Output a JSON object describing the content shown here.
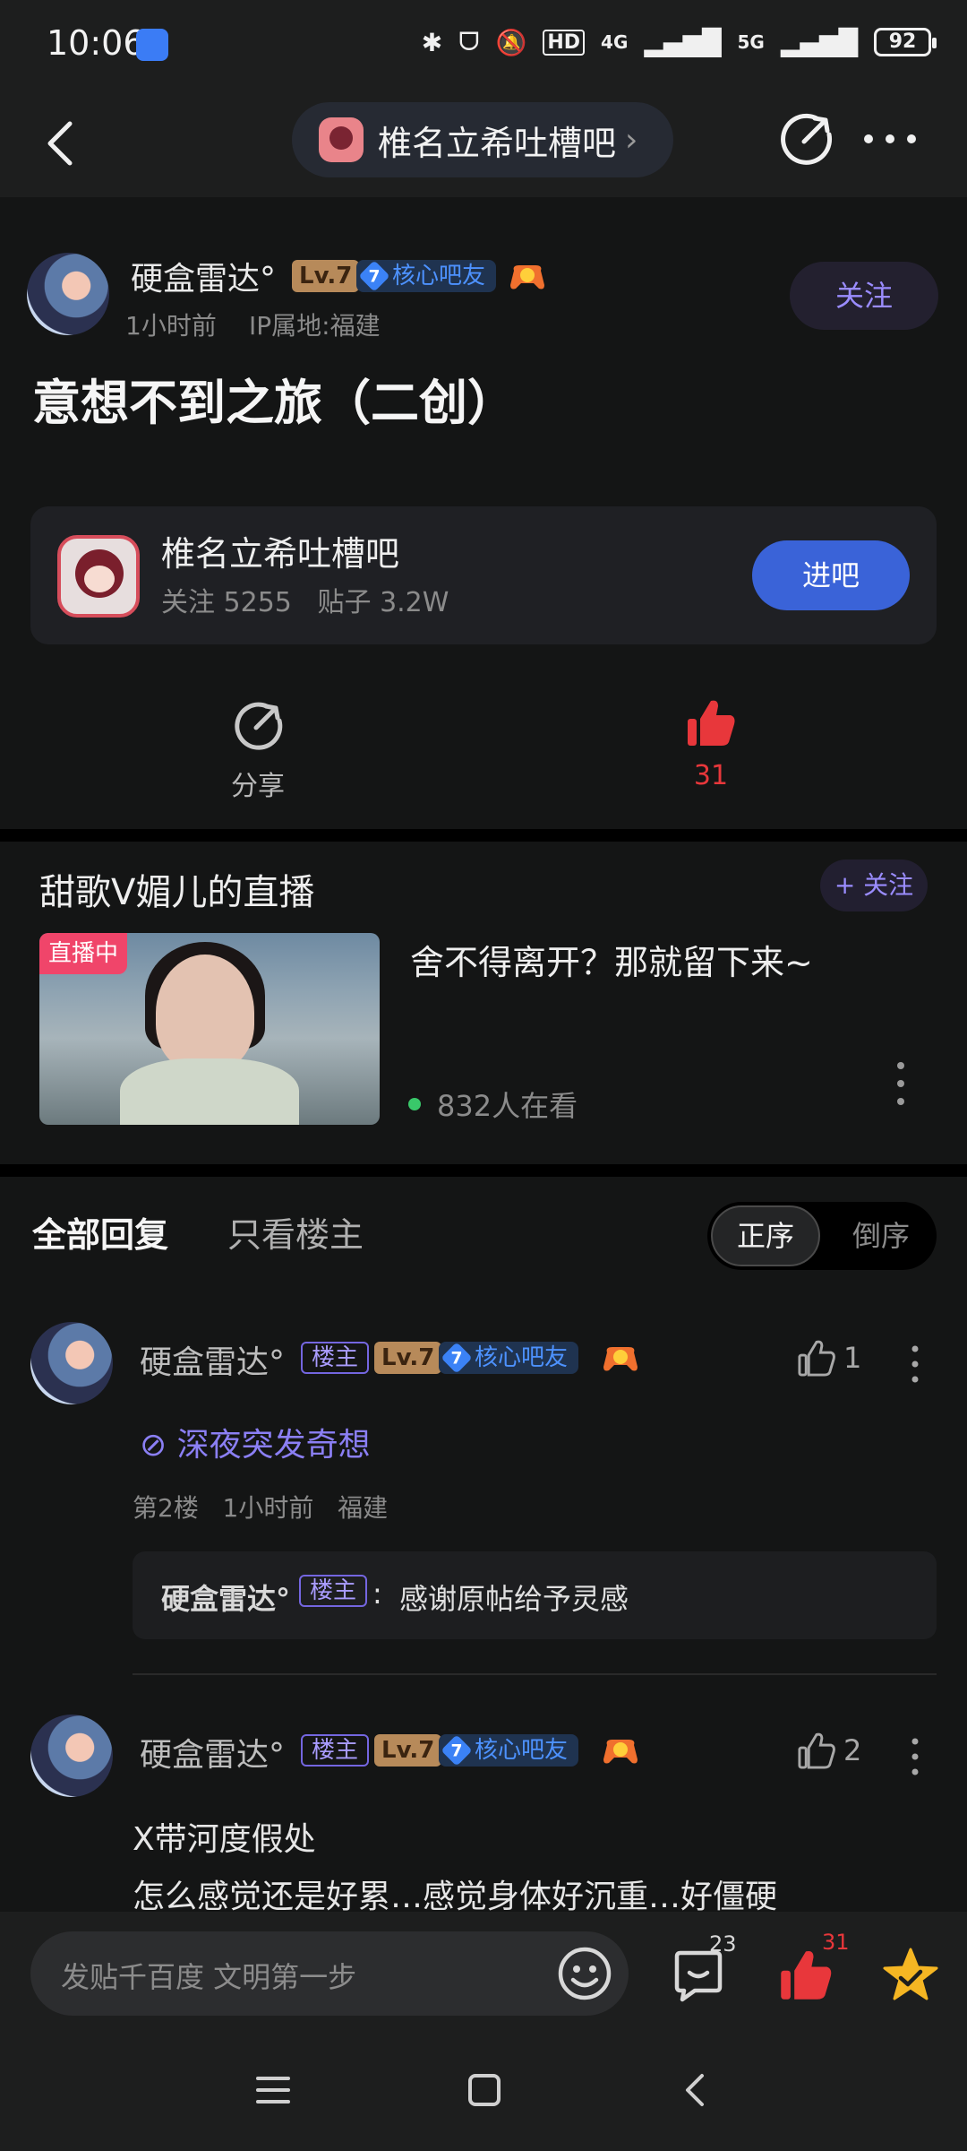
{
  "status": {
    "time": "10:06",
    "net1": "4G",
    "net2": "5G",
    "battery": "92"
  },
  "header": {
    "forum_name": "椎名立希吐槽吧"
  },
  "post": {
    "author": "硬盒雷达°",
    "level": "Lv.7",
    "core_level": "7",
    "core_badge": "核心吧友",
    "time": "1小时前",
    "ip": "IP属地:福建",
    "follow_label": "关注",
    "title": "意想不到之旅（二创）"
  },
  "forum_card": {
    "name": "椎名立希吐槽吧",
    "followers_label": "关注",
    "followers": "5255",
    "posts_label": "贴子",
    "posts": "3.2W",
    "enter_label": "进吧"
  },
  "actions": {
    "share_label": "分享",
    "like_count": "31"
  },
  "live": {
    "title": "甜歌V媚儿的直播",
    "follow_label": "+ 关注",
    "badge": "直播中",
    "text": "舍不得离开？那就留下来~",
    "viewers": "832人在看"
  },
  "replies": {
    "tab_all": "全部回复",
    "tab_owner": "只看楼主",
    "sort_asc": "正序",
    "sort_desc": "倒序",
    "items": [
      {
        "author": "硬盒雷达°",
        "owner_badge": "楼主",
        "level": "Lv.7",
        "core_level": "7",
        "core_badge": "核心吧友",
        "likes": "1",
        "link": "深夜突发奇想",
        "floor": "第2楼",
        "time": "1小时前",
        "location": "福建",
        "quote_author": "硬盒雷达°",
        "quote_badge": "楼主",
        "quote_text": "感谢原帖给予灵感"
      },
      {
        "author": "硬盒雷达°",
        "owner_badge": "楼主",
        "level": "Lv.7",
        "core_level": "7",
        "core_badge": "核心吧友",
        "likes": "2",
        "line1": "X带河度假处",
        "line2": "怎么感觉还是好累…感觉身体好沉重…好僵硬"
      }
    ]
  },
  "bottom": {
    "input_placeholder": "发贴千百度 文明第一步",
    "comment_count": "23",
    "like_count": "31"
  },
  "colors": {
    "accent": "#3a63d8",
    "purple": "#9a8cff",
    "like_red": "#e8373b",
    "star_gold": "#f5b623"
  }
}
